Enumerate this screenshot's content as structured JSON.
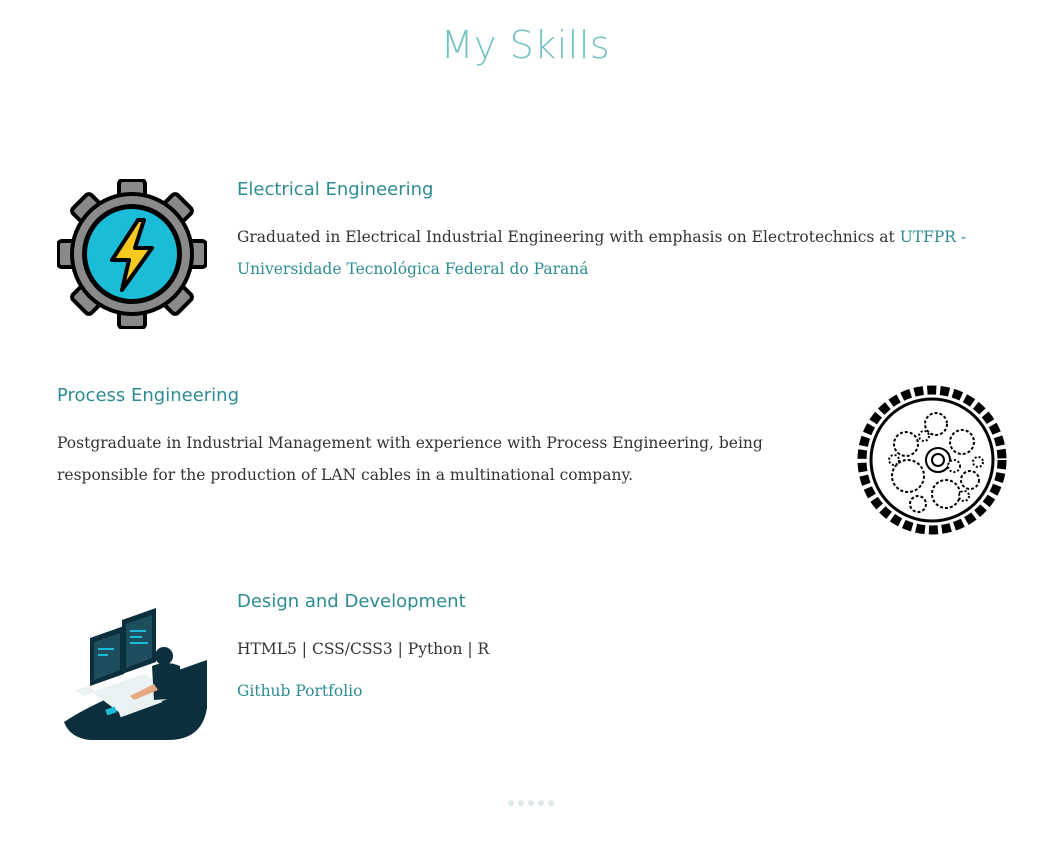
{
  "page": {
    "title": "My Skills"
  },
  "skills": [
    {
      "heading": "Electrical Engineering",
      "text": "Graduated in Electrical Industrial Engineering with emphasis on Electrotechnics at ",
      "link_text": "UTFPR - Universidade Tecnológica Federal do Paraná",
      "icon": "lightning-gear-icon"
    },
    {
      "heading": "Process Engineering",
      "text": "Postgraduate in Industrial Management with experience with Process Engineering, being responsible for the production of LAN cables in a multinational company.",
      "icon": "gears-circle-icon"
    },
    {
      "heading": "Design and Development",
      "text": "HTML5 | CSS/CSS3 | Python | R",
      "link_text": "Github Portfolio",
      "icon": "developer-workstation-icon"
    }
  ],
  "carousel": {
    "dot_count": 5
  },
  "colors": {
    "title": "#73c3c4",
    "accent": "#2c8c92",
    "text": "#333333"
  }
}
